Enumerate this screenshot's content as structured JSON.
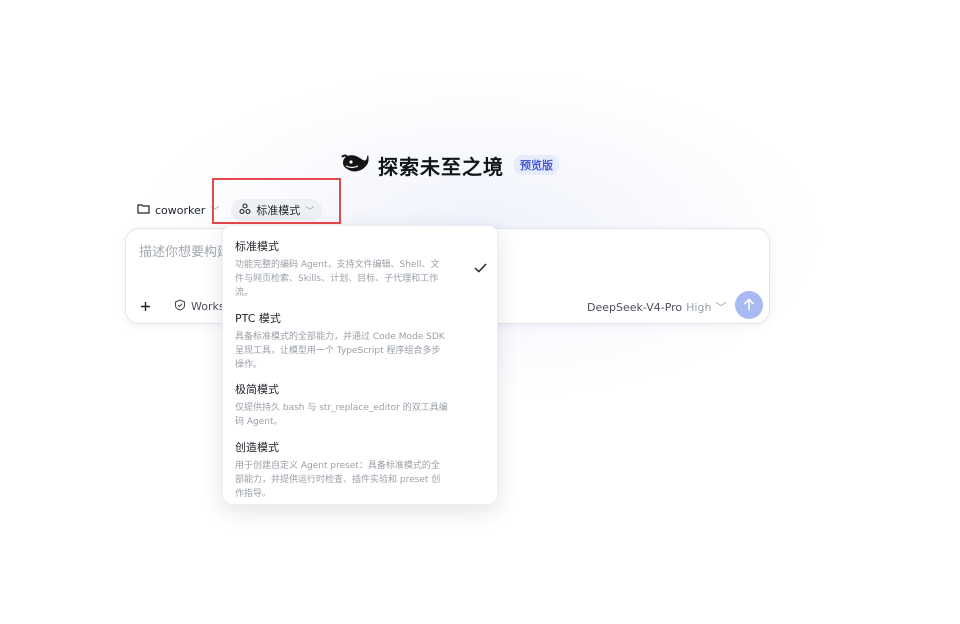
{
  "brand": {
    "title": "探索未至之境",
    "badge": "预览版"
  },
  "toolbar": {
    "folder_label": "coworker",
    "mode_label": "标准模式"
  },
  "composer": {
    "placeholder": "描述你想要构建",
    "works_label": "Works",
    "model_name": "DeepSeek-V4-Pro",
    "model_level": "High"
  },
  "mode_menu": {
    "selected": "标准模式",
    "items": [
      {
        "name": "标准模式",
        "desc": [
          "功能完整的编码 Agent，支持文件编辑、Shell、文",
          "件与网页检索、Skills、计划、目标、子代理和工作",
          "流。"
        ]
      },
      {
        "name": "PTC 模式",
        "desc": [
          "具备标准模式的全部能力，并通过 Code Mode SDK",
          "呈现工具，让模型用一个 TypeScript 程序组合多步",
          "操作。"
        ]
      },
      {
        "name": "极简模式",
        "desc": [
          "仅提供持久 bash 与 str_replace_editor 的双工具编",
          "码 Agent。"
        ]
      },
      {
        "name": "创造模式",
        "desc": [
          "用于创建自定义 Agent preset：具备标准模式的全",
          "部能力，并提供运行时检查、插件实验和 preset 创",
          "作指导。"
        ]
      }
    ]
  },
  "colors": {
    "highlight": "#e5484d",
    "send_button": "#a9b9f2",
    "badge_bg": "#e7ecfb",
    "badge_text": "#4b5fd6"
  },
  "icons": [
    "whale-logo-icon",
    "folder-icon",
    "mode-icon",
    "chevron-down-icon",
    "plus-icon",
    "works-icon",
    "arrow-up-icon",
    "check-icon"
  ]
}
